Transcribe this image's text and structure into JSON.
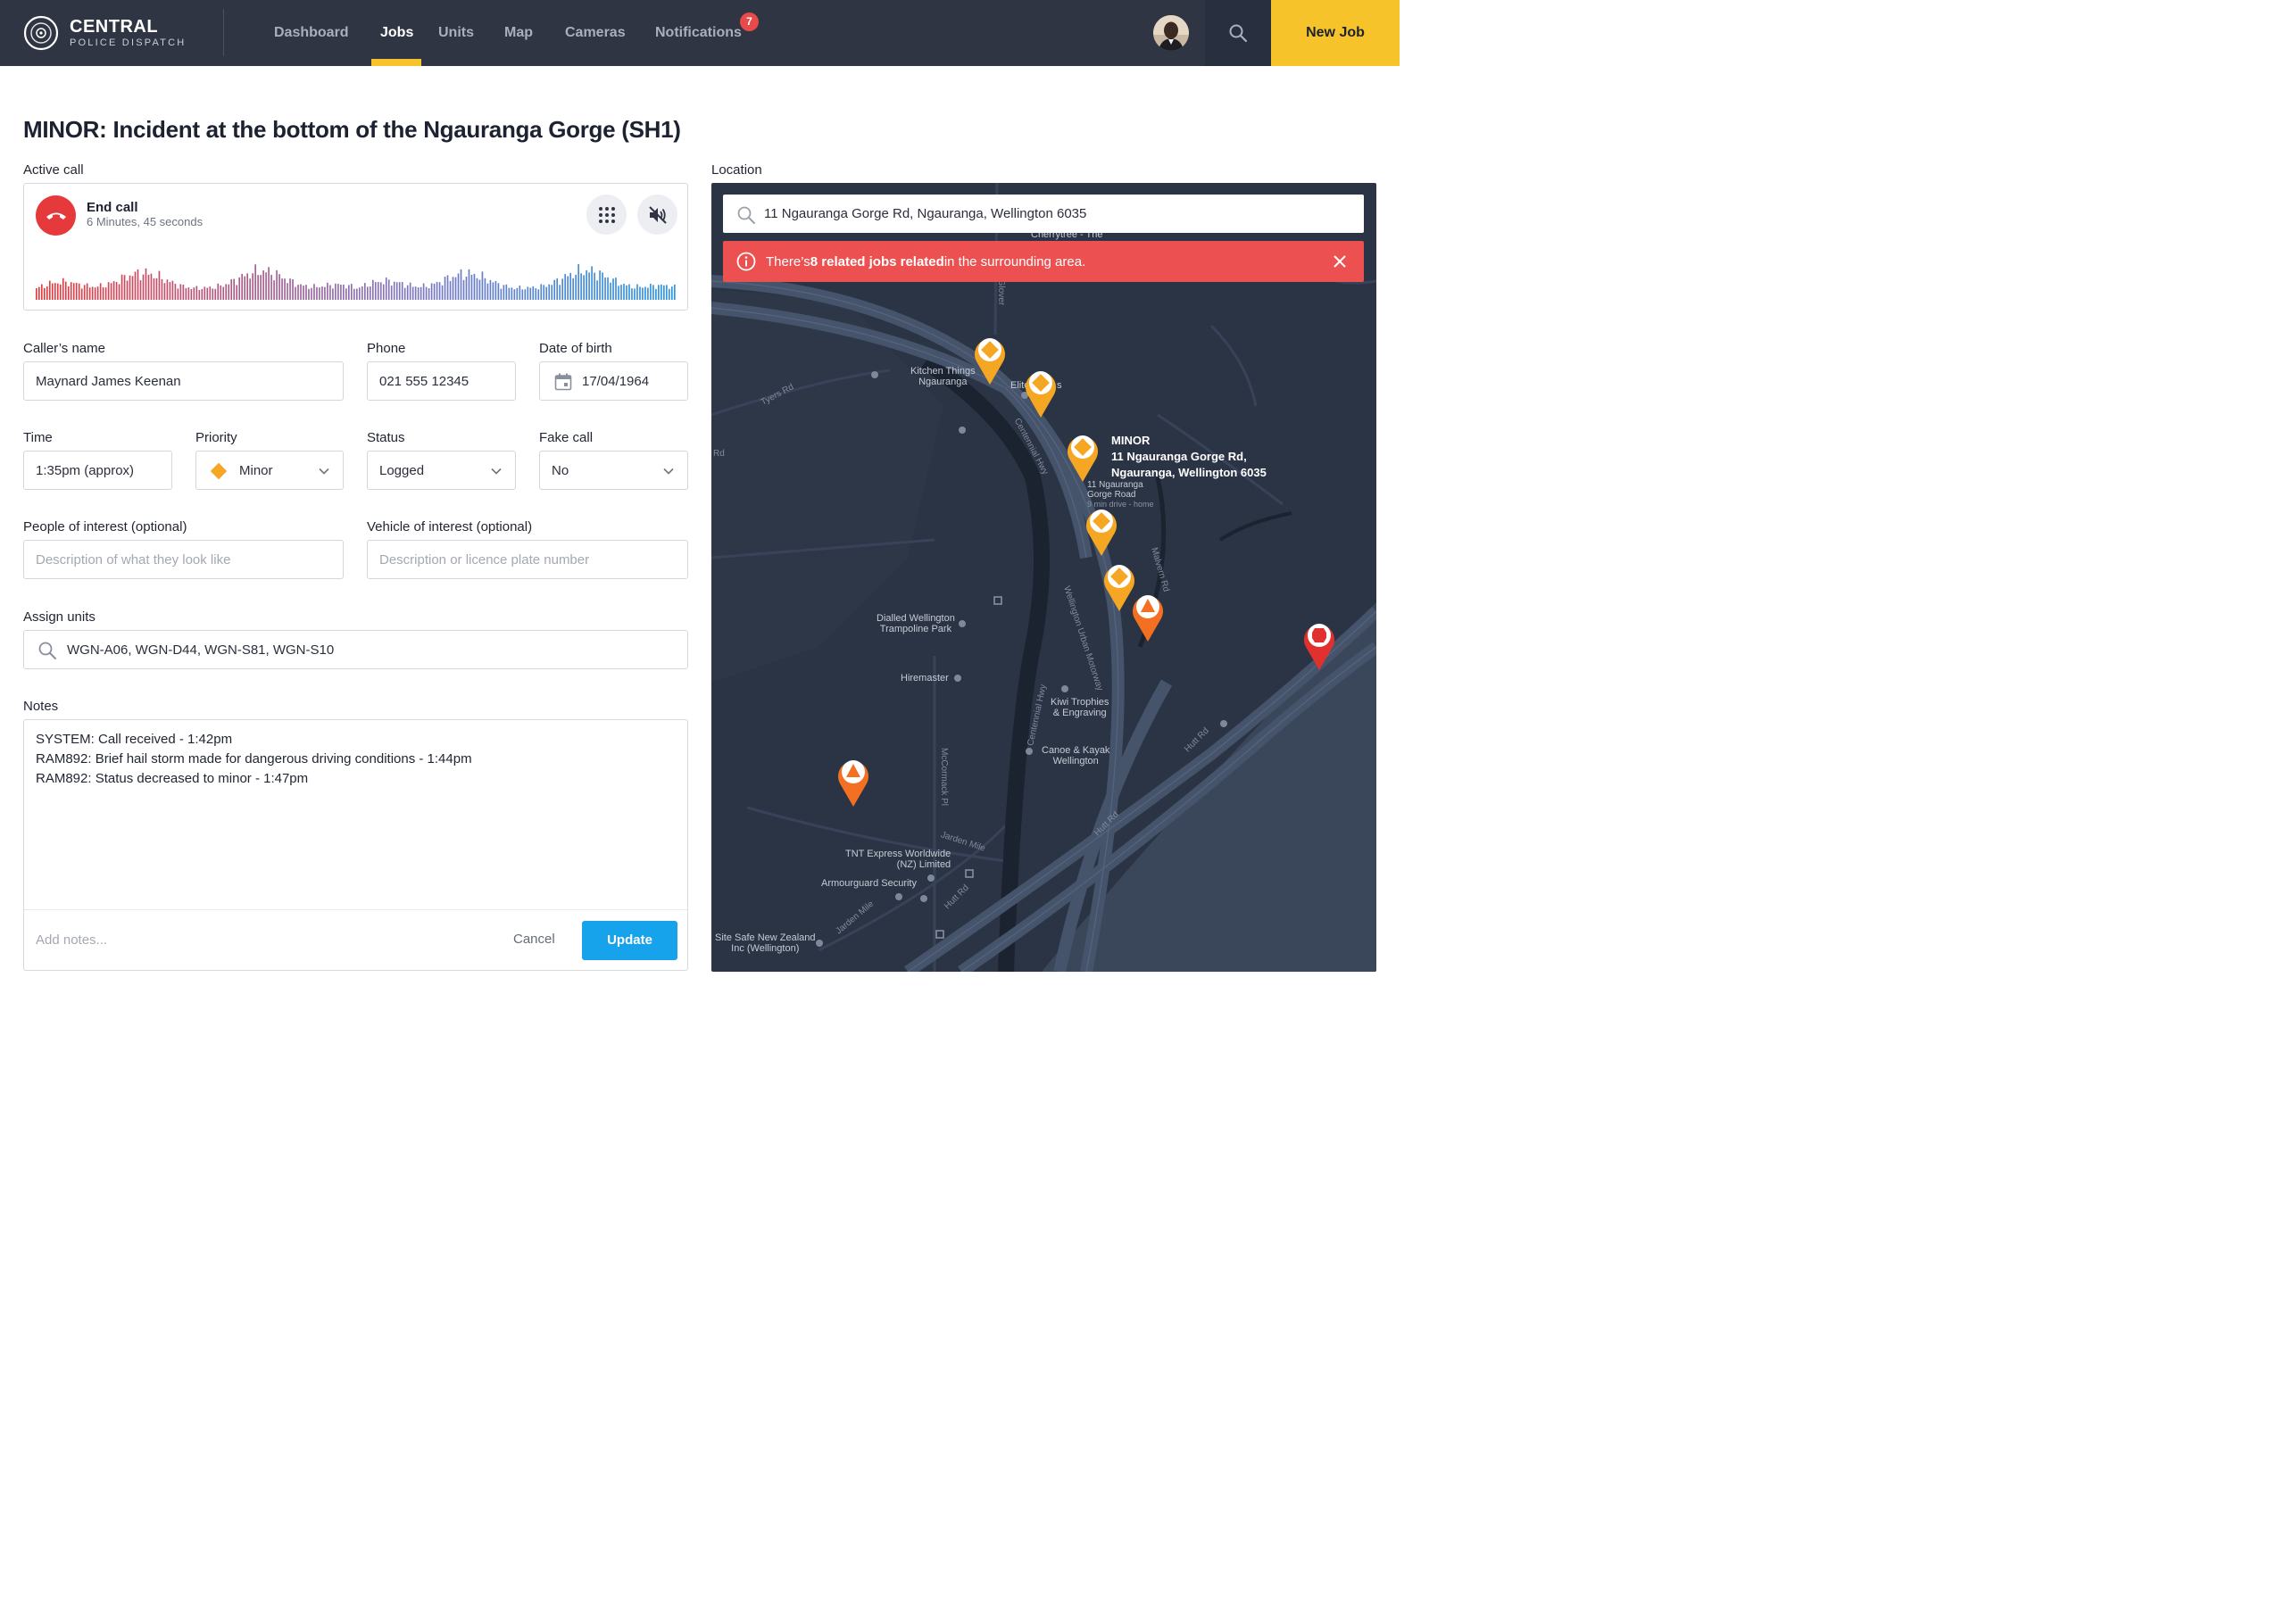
{
  "brand": {
    "name": "CENTRAL",
    "subtitle": "POLICE DISPATCH"
  },
  "nav": {
    "items": [
      {
        "label": "Dashboard"
      },
      {
        "label": "Jobs",
        "active": true
      },
      {
        "label": "Units"
      },
      {
        "label": "Map"
      },
      {
        "label": "Cameras"
      },
      {
        "label": "Notifications",
        "badge": "7"
      }
    ],
    "new_job_label": "New Job",
    "icons": [
      "search-icon",
      "avatar"
    ]
  },
  "job": {
    "title": "MINOR: Incident at the bottom of the Ngauranga Gorge (SH1)"
  },
  "active_call": {
    "section_label": "Active call",
    "end_call_label": "End call",
    "duration": "6 Minutes, 45 seconds",
    "icons": [
      "phone-end-icon",
      "dialpad-icon",
      "mute-icon"
    ]
  },
  "form": {
    "callers_name": {
      "label": "Caller’s name",
      "value": "Maynard James Keenan"
    },
    "phone": {
      "label": "Phone",
      "value": "021 555 12345"
    },
    "dob": {
      "label": "Date of birth",
      "value": "17/04/1964"
    },
    "time": {
      "label": "Time",
      "value": "1:35pm (approx)"
    },
    "priority": {
      "label": "Priority",
      "value": "Minor",
      "color": "#f5a623"
    },
    "status": {
      "label": "Status",
      "value": "Logged"
    },
    "fake_call": {
      "label": "Fake call",
      "value": "No"
    },
    "people": {
      "label": "People of interest (optional)",
      "placeholder": "Description of what they look like"
    },
    "vehicle": {
      "label": "Vehicle of interest (optional)",
      "placeholder": "Description or licence plate number"
    },
    "assign": {
      "label": "Assign units",
      "value": "WGN-A06, WGN-D44, WGN-S81, WGN-S10"
    }
  },
  "notes": {
    "label": "Notes",
    "entries": [
      "SYSTEM:  Call received  -  1:42pm",
      "RAM892:  Brief hail storm made for dangerous driving conditions  -  1:44pm",
      "RAM892:  Status decreased to minor  -  1:47pm"
    ],
    "add_placeholder": "Add notes...",
    "cancel_label": "Cancel",
    "update_label": "Update"
  },
  "location": {
    "label": "Location",
    "search_value": "11 Ngauranga Gorge Rd, Ngauranga, Wellington 6035",
    "alert": {
      "prefix": "There’s ",
      "bold": "8 related jobs related",
      "suffix": " in the surrounding area."
    },
    "selected_pin": {
      "title": "MINOR",
      "line1": "11 Ngauranga Gorge Rd,",
      "line2": "Ngauranga, Wellington 6035"
    },
    "places": [
      "Kitchen Things",
      "Ngauranga",
      "Elite",
      "11 Ngauranga",
      "Gorge Road",
      "9 min drive - home",
      "Dialled Wellington",
      "Trampoline Park",
      "Hiremaster",
      "Kiwi Trophies",
      "& Engraving",
      "Canoe & Kayak",
      "Wellington",
      "TNT Express Worldwide",
      "(NZ) Limited",
      "Armourguard Security",
      "Site Safe New Zealand",
      "Inc (Wellington)",
      "Cherrytree - The",
      "s"
    ],
    "roads": [
      "Tyers Rd",
      "Centennial Hwy",
      "Wellington Urban Motorway",
      "Malvern Rd",
      "Hutt Rd",
      "McCormack Pl",
      "Jarden Mile",
      "Glover",
      "Rd"
    ],
    "colors": {
      "minor": "#f5a623",
      "medium": "#f36f21",
      "critical": "#e0312f"
    }
  }
}
